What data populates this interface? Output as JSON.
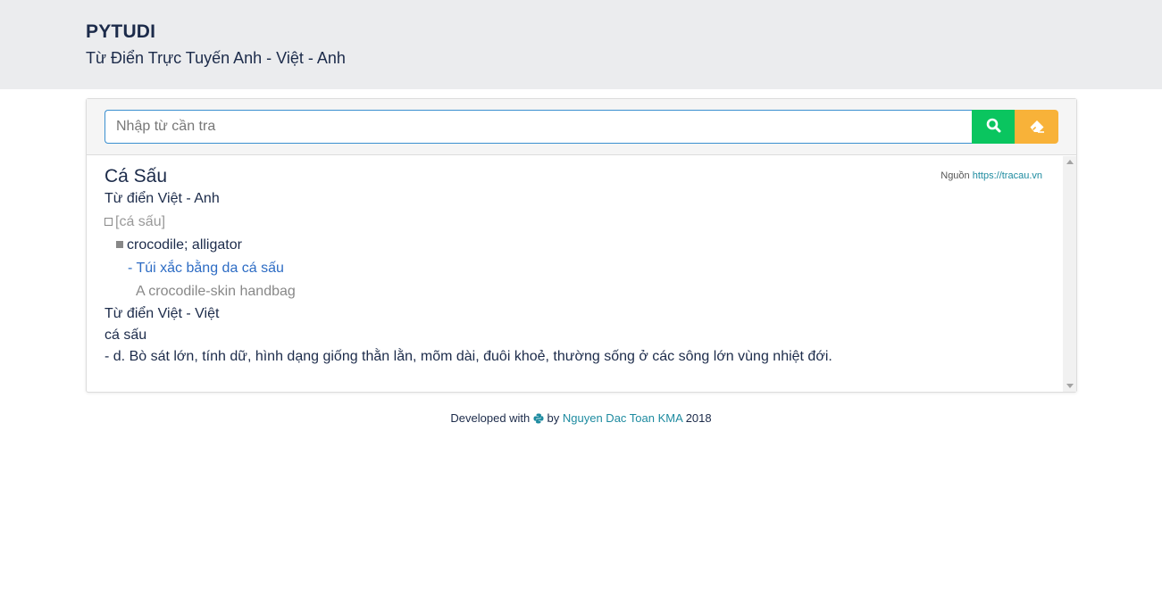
{
  "header": {
    "brand": "PYTUDI",
    "subtitle": "Từ Điển Trực Tuyến Anh - Việt - Anh"
  },
  "search": {
    "placeholder": "Nhập từ cần tra",
    "value": "",
    "search_icon": "search-icon",
    "clear_icon": "eraser-icon",
    "colors": {
      "search_button": "#0ac55f",
      "clear_button": "#f8b239",
      "input_border": "#3a8fd0"
    }
  },
  "result": {
    "title": "Cá Sấu",
    "source_label": "Nguồn",
    "source_link": "https://tracau.vn",
    "dict_en_label": "Từ điển Việt - Anh",
    "pronunciation": "[cá sấu]",
    "meaning": "crocodile; alligator",
    "example_dash": "-",
    "example": "Túi xắc bằng da cá sấu",
    "example_translation": "A crocodile-skin handbag",
    "dict_vi_label": "Từ điển Việt - Việt",
    "vi_word": "cá sấu",
    "vi_definition": "- d. Bò sát lớn, tính dữ, hình dạng giống thằn lằn, mõm dài, đuôi khoẻ, thường sống ở các sông lớn vùng nhiệt đới."
  },
  "footer": {
    "prefix": "Developed with",
    "icon": "python-icon",
    "by": "by",
    "author": "Nguyen Dac Toan KMA",
    "year": "2018"
  }
}
